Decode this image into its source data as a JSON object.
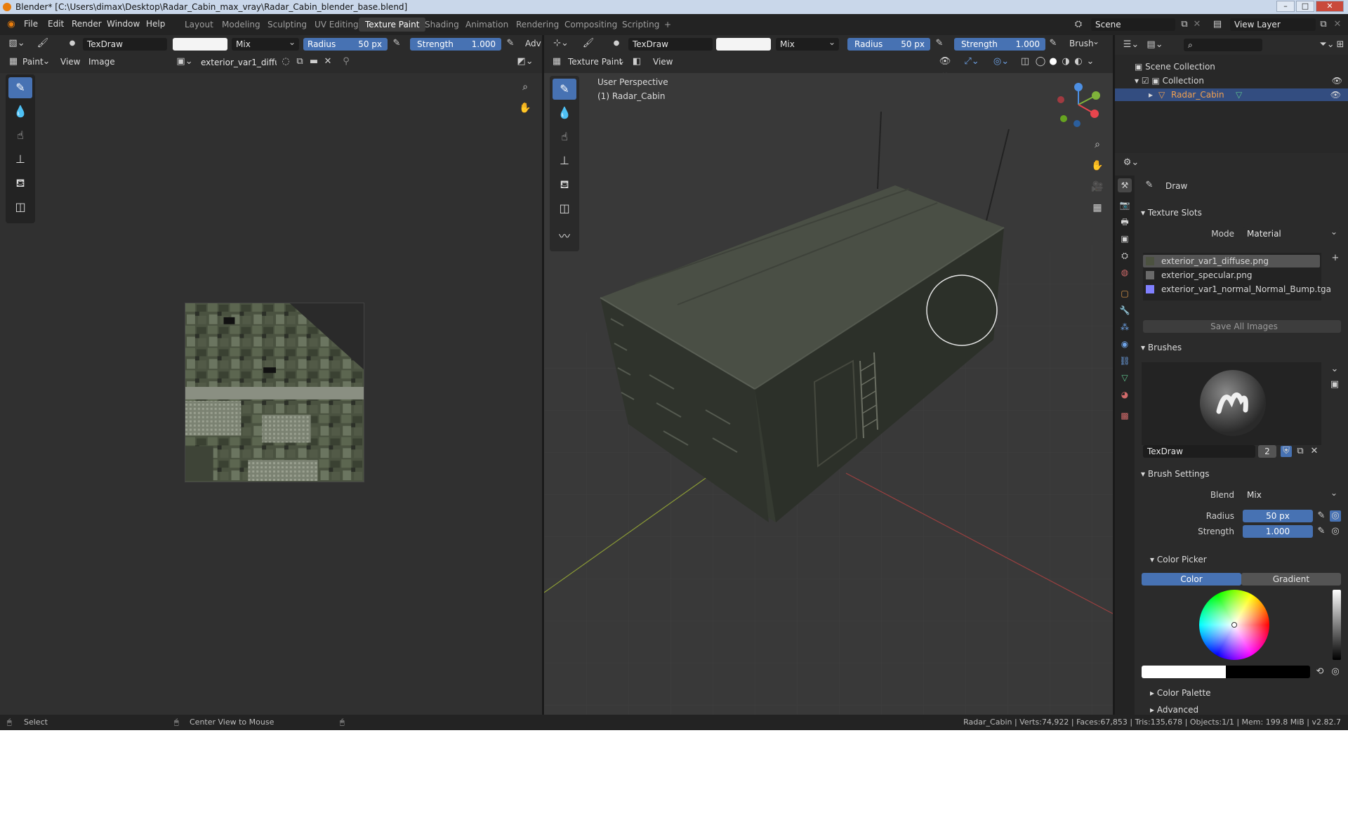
{
  "window": {
    "title": "Blender* [C:\\Users\\dimax\\Desktop\\Radar_Cabin_max_vray\\Radar_Cabin_blender_base.blend]",
    "buttons": [
      "–",
      "□",
      "✕"
    ]
  },
  "menu": [
    "File",
    "Edit",
    "Render",
    "Window",
    "Help"
  ],
  "workspaces": [
    "Layout",
    "Modeling",
    "Sculpting",
    "UV Editing",
    "Texture Paint",
    "Shading",
    "Animation",
    "Rendering",
    "Compositing",
    "Scripting",
    "+"
  ],
  "active_workspace": "Texture Paint",
  "scene": {
    "label": "Scene",
    "view_layer": "View Layer"
  },
  "left_tool_header": {
    "brush": "TexDraw",
    "blend": "Mix",
    "radius_label": "Radius",
    "radius_value": "50 px",
    "strength_label": "Strength",
    "strength_value": "1.000",
    "adv": "Adv"
  },
  "image_editor": {
    "mode": "Paint",
    "menus": [
      "View",
      "Image"
    ],
    "image_name": "exterior_var1_diffus.."
  },
  "viewport_tool_header": {
    "brush": "TexDraw",
    "blend": "Mix",
    "radius_label": "Radius",
    "radius_value": "50 px",
    "strength_label": "Strength",
    "strength_value": "1.000",
    "brush_menu": "Brush"
  },
  "viewport": {
    "mode": "Texture Paint",
    "menu": "View",
    "perspective": "User Perspective",
    "object": "(1) Radar_Cabin"
  },
  "outliner": {
    "root": "Scene Collection",
    "collection": "Collection",
    "object": "Radar_Cabin"
  },
  "properties": {
    "tool_name": "Draw",
    "texture_slots": {
      "title": "Texture Slots",
      "mode_label": "Mode",
      "mode_value": "Material",
      "slots": [
        "exterior_var1_diffuse.png",
        "exterior_specular.png",
        "exterior_var1_normal_Normal_Bump.tga"
      ],
      "save_all": "Save All Images"
    },
    "brushes": {
      "title": "Brushes",
      "name": "TexDraw",
      "users": "2"
    },
    "brush_settings": {
      "title": "Brush Settings",
      "blend_label": "Blend",
      "blend_value": "Mix",
      "radius_label": "Radius",
      "radius_value": "50 px",
      "strength_label": "Strength",
      "strength_value": "1.000",
      "color_picker": "Color Picker",
      "color_tab": "Color",
      "gradient_tab": "Gradient",
      "color_palette": "Color Palette",
      "advanced": "Advanced"
    }
  },
  "status": {
    "select": "Select",
    "center": "Center View to Mouse",
    "stats": "Radar_Cabin | Verts:74,922 | Faces:67,853 | Tris:135,678 | Objects:1/1 | Mem: 199.8 MiB | v2.82.7"
  },
  "colors": {
    "accent": "#4772b3",
    "selected_row": "#334d80",
    "brush_color": "#ffffff"
  }
}
